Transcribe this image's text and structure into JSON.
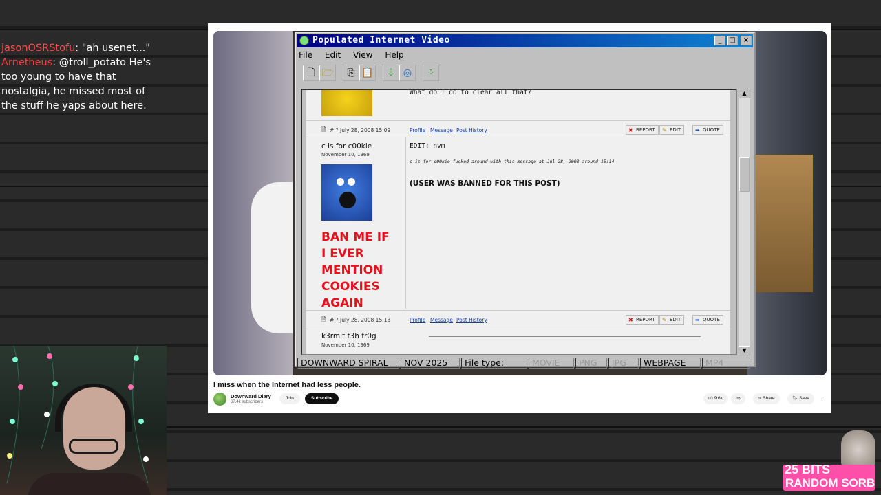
{
  "chat": [
    {
      "user": "jasonOSRStofu",
      "text": ": \"ah usenet...\""
    },
    {
      "user": "Arnetheus",
      "text": ": @troll_potato He's too young to have that nostalgia, he missed most of the stuff he yaps about here."
    }
  ],
  "youtube": {
    "video_title": "I miss when the Internet had less people.",
    "channel_name": "Downward Diary",
    "channel_subs": "67.4k subscribers",
    "join_label": "Join",
    "subscribe_label": "Subscribe",
    "likes": "9.6k",
    "share_label": "Share",
    "save_label": "Save",
    "more_label": "…"
  },
  "window": {
    "title": "Populated Internet Video",
    "menu": [
      "File",
      "Edit",
      "View",
      "Help"
    ],
    "status": {
      "left": "DOWNWARD SPIRAL",
      "date": "NOV 2025",
      "filetype_label": "File type:",
      "types": [
        {
          "label": "MOVIE",
          "active": false
        },
        {
          "label": "PNG",
          "active": false
        },
        {
          "label": "JPG",
          "active": false
        },
        {
          "label": "WEBPAGE",
          "active": true
        },
        {
          "label": "MP4",
          "active": false
        }
      ]
    }
  },
  "forum": {
    "prev_post_text": "What do I do to clear all that?",
    "post1": {
      "meta": "# ? July 28, 2008 15:09",
      "links": [
        "Profile",
        "Message",
        "Post History"
      ],
      "buttons": [
        "REPORT",
        "EDIT",
        "QUOTE"
      ]
    },
    "post2": {
      "user": "c is for c00kie",
      "join_date": "November 10, 1969",
      "body": "EDIT: nvm",
      "edit_note": "c is for c00kie fucked around with this message at Jul 28, 2008 around 15:14",
      "ban_note": "(USER WAS BANNED FOR THIS POST)",
      "signature": "BAN ME IF I EVER MENTION COOKIES AGAIN",
      "meta": "# ? July 28, 2008 15:13",
      "links": [
        "Profile",
        "Message",
        "Post History"
      ],
      "buttons": [
        "REPORT",
        "EDIT",
        "QUOTE"
      ]
    },
    "post3": {
      "user": "k3rmit t3h fr0g",
      "join_date": "November 10, 1969"
    }
  },
  "branding": {
    "line1": "25 BITS",
    "line2": "RANDOM SORB"
  }
}
